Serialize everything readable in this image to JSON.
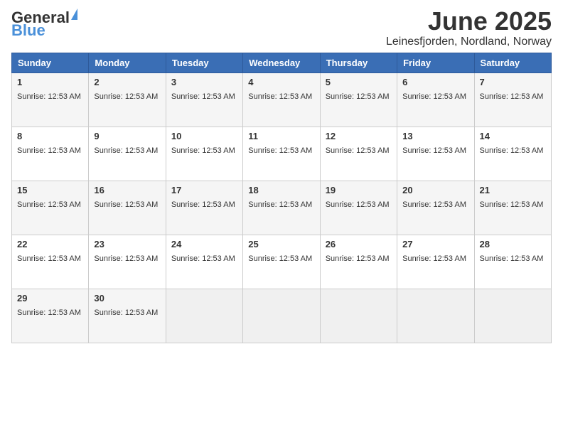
{
  "logo": {
    "text_general": "General",
    "text_blue": "Blue"
  },
  "header": {
    "month_year": "June 2025",
    "location": "Leinesfjorden, Nordland, Norway"
  },
  "days_of_week": [
    "Sunday",
    "Monday",
    "Tuesday",
    "Wednesday",
    "Thursday",
    "Friday",
    "Saturday"
  ],
  "sunrise_label": "Sunrise: 12:53 AM",
  "weeks": [
    [
      {
        "day": "1",
        "sunrise": "Sunrise: 12:53 AM"
      },
      {
        "day": "2",
        "sunrise": "Sunrise: 12:53 AM"
      },
      {
        "day": "3",
        "sunrise": "Sunrise: 12:53 AM"
      },
      {
        "day": "4",
        "sunrise": "Sunrise: 12:53 AM"
      },
      {
        "day": "5",
        "sunrise": "Sunrise: 12:53 AM"
      },
      {
        "day": "6",
        "sunrise": "Sunrise: 12:53 AM"
      },
      {
        "day": "7",
        "sunrise": "Sunrise: 12:53 AM"
      }
    ],
    [
      {
        "day": "8",
        "sunrise": "Sunrise: 12:53 AM"
      },
      {
        "day": "9",
        "sunrise": "Sunrise: 12:53 AM"
      },
      {
        "day": "10",
        "sunrise": "Sunrise: 12:53 AM"
      },
      {
        "day": "11",
        "sunrise": "Sunrise: 12:53 AM"
      },
      {
        "day": "12",
        "sunrise": "Sunrise: 12:53 AM"
      },
      {
        "day": "13",
        "sunrise": "Sunrise: 12:53 AM"
      },
      {
        "day": "14",
        "sunrise": "Sunrise: 12:53 AM"
      }
    ],
    [
      {
        "day": "15",
        "sunrise": "Sunrise: 12:53 AM"
      },
      {
        "day": "16",
        "sunrise": "Sunrise: 12:53 AM"
      },
      {
        "day": "17",
        "sunrise": "Sunrise: 12:53 AM"
      },
      {
        "day": "18",
        "sunrise": "Sunrise: 12:53 AM"
      },
      {
        "day": "19",
        "sunrise": "Sunrise: 12:53 AM"
      },
      {
        "day": "20",
        "sunrise": "Sunrise: 12:53 AM"
      },
      {
        "day": "21",
        "sunrise": "Sunrise: 12:53 AM"
      }
    ],
    [
      {
        "day": "22",
        "sunrise": "Sunrise: 12:53 AM"
      },
      {
        "day": "23",
        "sunrise": "Sunrise: 12:53 AM"
      },
      {
        "day": "24",
        "sunrise": "Sunrise: 12:53 AM"
      },
      {
        "day": "25",
        "sunrise": "Sunrise: 12:53 AM"
      },
      {
        "day": "26",
        "sunrise": "Sunrise: 12:53 AM"
      },
      {
        "day": "27",
        "sunrise": "Sunrise: 12:53 AM"
      },
      {
        "day": "28",
        "sunrise": "Sunrise: 12:53 AM"
      }
    ],
    [
      {
        "day": "29",
        "sunrise": "Sunrise: 12:53 AM"
      },
      {
        "day": "30",
        "sunrise": "Sunrise: 12:53 AM"
      },
      null,
      null,
      null,
      null,
      null
    ]
  ]
}
